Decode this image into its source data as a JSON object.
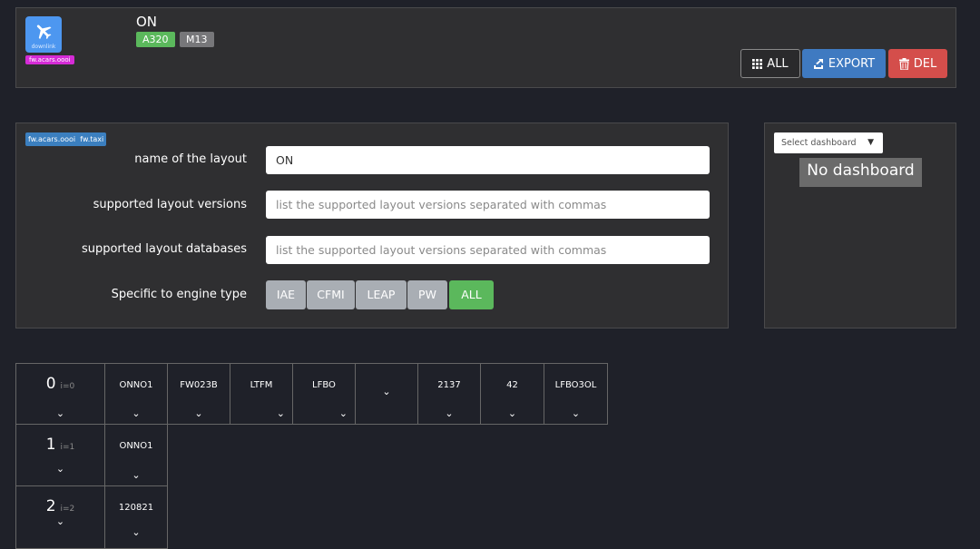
{
  "header": {
    "app_icon_label": "downlink",
    "app_tag": "fw.acars.oooi",
    "title": "ON",
    "badges": [
      "A320",
      "M13"
    ],
    "buttons": {
      "all": "ALL",
      "export": "EXPORT",
      "del": "DEL"
    }
  },
  "form": {
    "tags": "fw.acars.oooi  fw.taxi",
    "name_label": "name of the layout",
    "name_value": "ON",
    "versions_label": "supported layout versions",
    "versions_placeholder": "list the supported layout versions separated with commas",
    "databases_label": "supported layout databases",
    "databases_placeholder": "list the supported layout versions separated with commas",
    "engine_label": "Specific to engine type",
    "engine_options": [
      "IAE",
      "CFMI",
      "LEAP",
      "PW",
      "ALL"
    ],
    "engine_selected": "ALL"
  },
  "dashboard": {
    "select_placeholder": "Select dashboard",
    "empty_text": "No dashboard"
  },
  "grid": {
    "rows": [
      {
        "index": "0",
        "sub": "i=0",
        "cells": [
          "ONNO1",
          "FW023B",
          "LTFM",
          "LFBO",
          "",
          "2137",
          "42",
          "LFBO3OL"
        ]
      },
      {
        "index": "1",
        "sub": "i=1",
        "cells": [
          "ONNO1"
        ]
      },
      {
        "index": "2",
        "sub": "i=2",
        "cells": [
          "120821"
        ]
      }
    ]
  },
  "colors": {
    "background": "#1f2129",
    "panel": "#2f2f31",
    "accent_blue": "#3f7ac1",
    "success_green": "#5bb85c",
    "danger_red": "#d44e4b",
    "tag_magenta": "#d52bd6"
  },
  "icons": [
    "airplane-icon",
    "grid-icon",
    "export-icon",
    "trash-icon",
    "chevron-down-icon",
    "caret-down-icon"
  ]
}
